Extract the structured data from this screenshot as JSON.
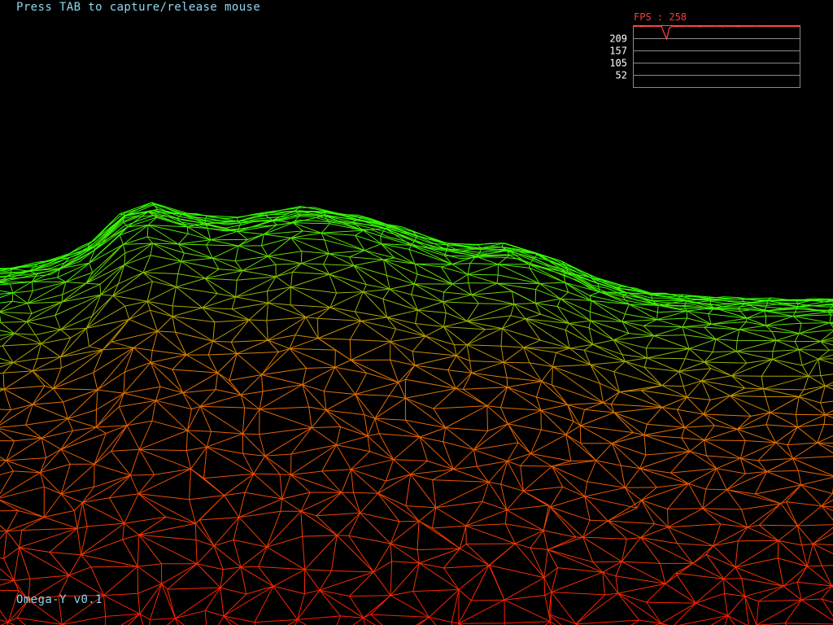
{
  "hud": {
    "hint": "Press TAB to capture/release mouse",
    "version": "Omega-Y v0.1"
  },
  "fps_graph": {
    "label": "FPS : 258",
    "fps": 258,
    "ticks": [
      "209",
      "157",
      "105",
      "52"
    ],
    "tick_values": [
      209,
      157,
      105,
      52
    ],
    "y_max": 261,
    "series_color": "#ff3b3b",
    "samples": [
      258,
      258,
      259,
      257,
      258,
      258,
      258,
      258,
      259,
      258,
      258,
      258,
      230,
      205,
      250,
      258,
      258,
      257,
      258,
      258,
      258,
      259,
      258,
      258,
      258,
      258,
      257,
      258,
      258,
      258,
      258,
      258,
      259,
      258,
      258,
      256,
      258,
      258,
      258,
      258,
      258,
      257,
      258,
      258,
      258,
      258,
      258,
      258,
      259,
      258,
      258,
      258,
      258,
      258,
      258,
      258,
      258,
      258,
      258,
      258,
      258,
      258,
      258,
      258,
      258,
      258
    ]
  },
  "colors": {
    "background": "#000000",
    "terrain_low": "#ff1a00",
    "terrain_mid": "#e07a00",
    "terrain_high": "#33ff00",
    "hud_text": "#8fd6ee"
  },
  "icons": {
    "terrain": "wireframe-terrain-mesh"
  }
}
